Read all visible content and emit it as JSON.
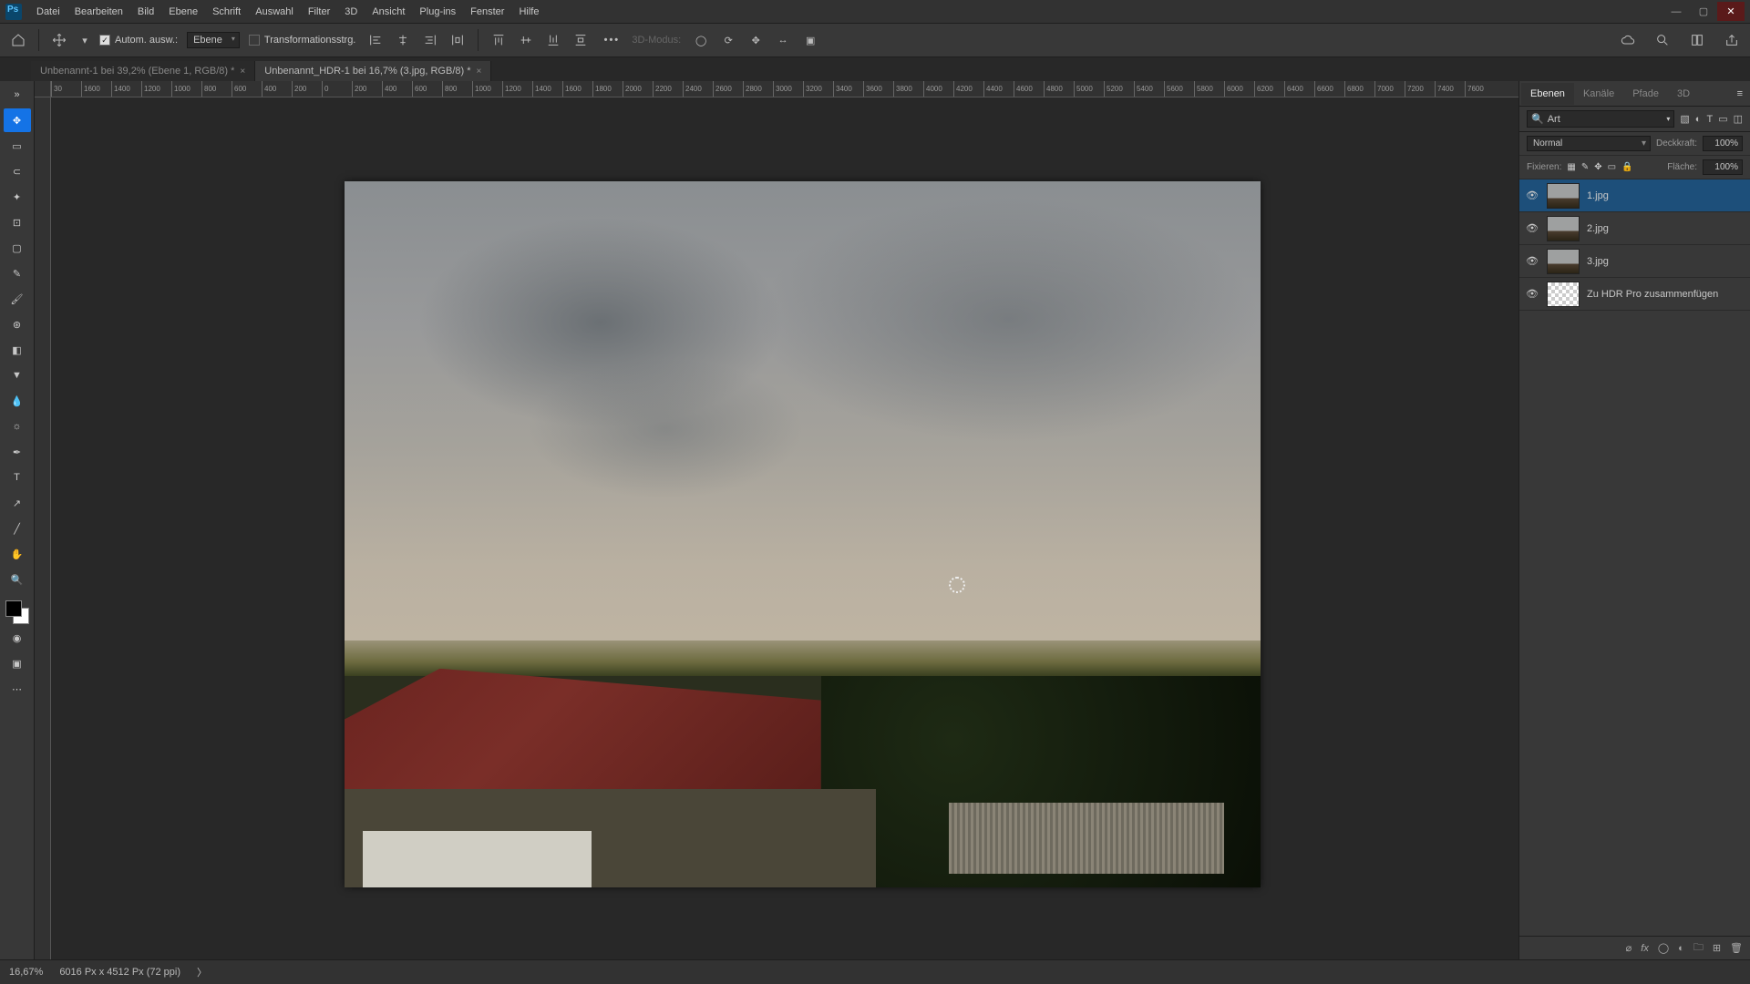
{
  "menu": {
    "items": [
      "Datei",
      "Bearbeiten",
      "Bild",
      "Ebene",
      "Schrift",
      "Auswahl",
      "Filter",
      "3D",
      "Ansicht",
      "Plug-ins",
      "Fenster",
      "Hilfe"
    ]
  },
  "window_controls": {
    "min": "—",
    "max": "▢",
    "close": "✕"
  },
  "options": {
    "auto_select_checked": true,
    "auto_select_label": "Autom. ausw.:",
    "select_mode": "Ebene",
    "transform_checked": false,
    "transform_label": "Transformationsstrg.",
    "more": "•••",
    "mode3d_label": "3D-Modus:"
  },
  "tabs": [
    {
      "label": "Unbenannt-1 bei 39,2% (Ebene 1, RGB/8) *",
      "active": false
    },
    {
      "label": "Unbenannt_HDR-1 bei 16,7% (3.jpg, RGB/8) *",
      "active": true
    }
  ],
  "ruler_h": [
    "30",
    "1600",
    "1400",
    "1200",
    "1000",
    "800",
    "600",
    "400",
    "200",
    "0",
    "200",
    "400",
    "600",
    "800",
    "1000",
    "1200",
    "1400",
    "1600",
    "1800",
    "2000",
    "2200",
    "2400",
    "2600",
    "2800",
    "3000",
    "3200",
    "3400",
    "3600",
    "3800",
    "4000",
    "4200",
    "4400",
    "4600",
    "4800",
    "5000",
    "5200",
    "5400",
    "5600",
    "5800",
    "6000",
    "6200",
    "6400",
    "6600",
    "6800",
    "7000",
    "7200",
    "7400",
    "7600"
  ],
  "rightpanel": {
    "tabs": [
      "Ebenen",
      "Kanäle",
      "Pfade",
      "3D"
    ],
    "active_tab": 0,
    "search_placeholder": "Art",
    "blend_mode": "Normal",
    "opacity_label": "Deckkraft:",
    "opacity_value": "100%",
    "lock_label": "Fixieren:",
    "fill_label": "Fläche:",
    "fill_value": "100%"
  },
  "layers": [
    {
      "name": "1.jpg",
      "visible": true,
      "selected": true,
      "thumb": "img"
    },
    {
      "name": "2.jpg",
      "visible": true,
      "selected": false,
      "thumb": "img"
    },
    {
      "name": "3.jpg",
      "visible": true,
      "selected": false,
      "thumb": "img"
    },
    {
      "name": "Zu HDR Pro zusammenfügen",
      "visible": true,
      "selected": false,
      "thumb": "checker"
    }
  ],
  "status": {
    "zoom": "16,67%",
    "docinfo": "6016 Px x 4512 Px (72 ppi)",
    "arrow": "〉"
  },
  "tools": [
    "move",
    "artboard",
    "lasso",
    "wand",
    "crop",
    "frame",
    "eyedropper-alt",
    "brush",
    "clone",
    "eraser",
    "gradient",
    "blur",
    "dodge",
    "pen",
    "type",
    "path",
    "line",
    "hand",
    "zoom"
  ]
}
